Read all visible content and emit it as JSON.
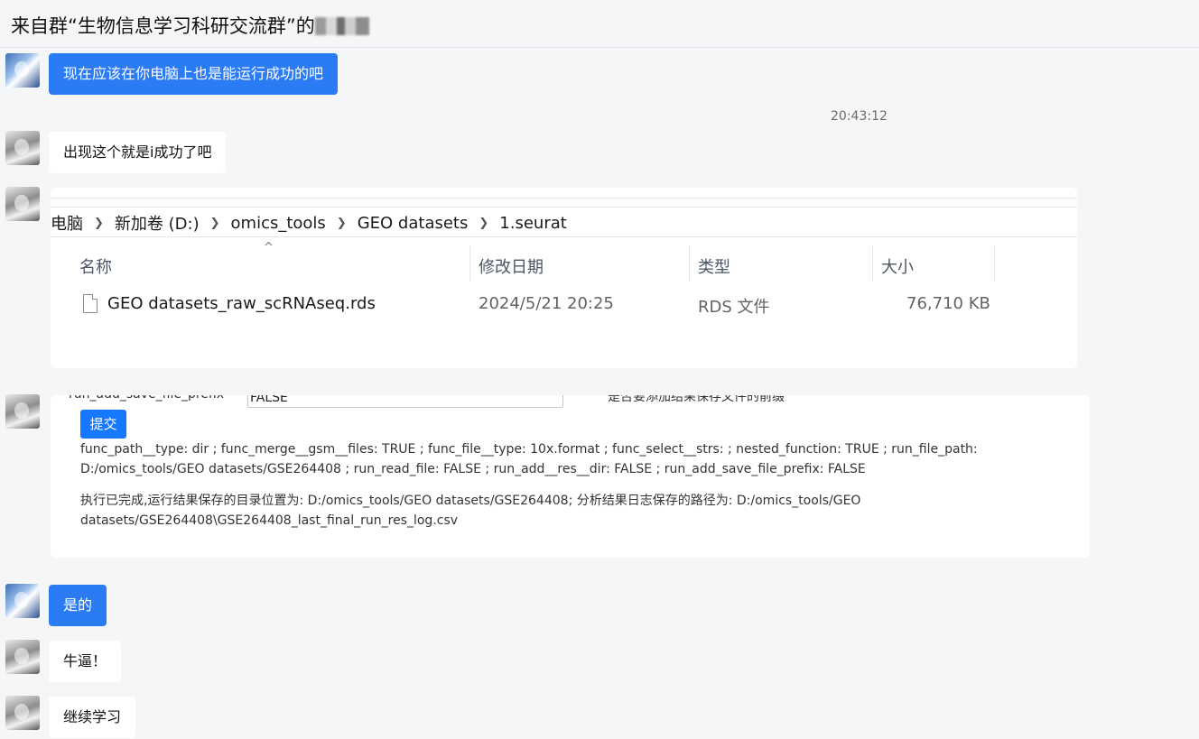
{
  "header": {
    "title": "来自群“生物信息学习科研交流群”的"
  },
  "messages": [
    {
      "text": "现在应该在你电脑上也是能运行成功的吧"
    },
    {
      "text": "出现这个就是i成功了吧"
    },
    {
      "text": "是的"
    },
    {
      "text": "牛逼！"
    },
    {
      "text": "继续学习"
    }
  ],
  "timestamp": "20:43:12",
  "explorer": {
    "breadcrumb": [
      "电脑",
      "新加卷 (D:)",
      "omics_tools",
      "GEO datasets",
      "1.seurat"
    ],
    "columns": [
      "名称",
      "修改日期",
      "类型",
      "大小"
    ],
    "files": [
      {
        "name": "GEO datasets_raw_scRNAseq.rds",
        "modified": "2024/5/21 20:25",
        "type": "RDS 文件",
        "size": "76,710 KB"
      }
    ]
  },
  "result_card": {
    "field_label": "run_add_save_file_prefix",
    "field_value": "FALSE",
    "field_desc": "是否要添加结果保存文件的前缀",
    "submit_label": "提交",
    "params_text": "func_path__type: dir ; func_merge__gsm__files: TRUE ; func_file__type: 10x.format ; func_select__strs: ; nested_function: TRUE ; run_file_path: D:/omics_tools/GEO datasets/GSE264408 ; run_read_file: FALSE ; run_add__res__dir: FALSE ; run_add_save_file_prefix: FALSE",
    "done_text": "执行已完成,运行结果保存的目录位置为: D:/omics_tools/GEO datasets/GSE264408; 分析结果日志保存的路径为: D:/omics_tools/GEO datasets/GSE264408\\GSE264408_last_final_run_res_log.csv"
  },
  "colors": {
    "own_bubble": "#2b7bf5",
    "submit_button": "#1677ff"
  }
}
